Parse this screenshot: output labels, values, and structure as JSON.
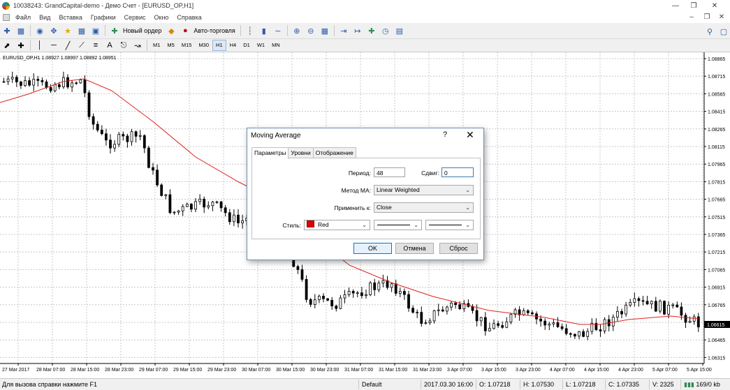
{
  "window": {
    "title": "10038243: GrandCapital-demo - Демо Счет - [EURUSD_OP,H1]",
    "minimize": "—",
    "maximize": "❐",
    "close": "✕"
  },
  "menu": {
    "items": [
      "Файл",
      "Вид",
      "Вставка",
      "Графики",
      "Сервис",
      "Окно",
      "Справка"
    ],
    "mdi_minimize": "–",
    "mdi_restore": "❐",
    "mdi_close": "✕"
  },
  "toolbar": {
    "new_order": "Новый ордер",
    "autotrading": "Авто-торговля"
  },
  "timeframes": {
    "items": [
      "M1",
      "M5",
      "M15",
      "M30",
      "H1",
      "H4",
      "D1",
      "W1",
      "MN"
    ],
    "active": "H1"
  },
  "chart": {
    "symbol_info": "EURUSD_OP,H1  1.08927 1.08997 1.08892 1.08951",
    "price_labels": [
      "1.08865",
      "1.08715",
      "1.08565",
      "1.08415",
      "1.08265",
      "1.08115",
      "1.07965",
      "1.07815",
      "1.07665",
      "1.07515",
      "1.07365",
      "1.07215",
      "1.07065",
      "1.06915",
      "1.06765",
      "1.06615",
      "1.06465",
      "1.06315"
    ],
    "price_top_label": "1.08865",
    "current_price": "1.06615",
    "time_labels": [
      "27 Mar 2017",
      "28 Mar 07:00",
      "28 Mar 15:00",
      "28 Mar 23:00",
      "29 Mar 07:00",
      "29 Mar 15:00",
      "29 Mar 23:00",
      "30 Mar 07:00",
      "30 Mar 15:00",
      "30 Mar 23:00",
      "31 Mar 07:00",
      "31 Mar 15:00",
      "31 Mar 23:00",
      "3 Apr 07:00",
      "3 Apr 15:00",
      "3 Apr 23:00",
      "4 Apr 07:00",
      "4 Apr 15:00",
      "4 Apr 23:00",
      "5 Apr 07:00",
      "5 Apr 15:00"
    ],
    "ma_color": "#e02020",
    "candle_color": "#000000"
  },
  "dialog": {
    "title": "Moving Average",
    "help": "?",
    "close": "✕",
    "tabs": [
      "Параметры",
      "Уровни",
      "Отображение"
    ],
    "active_tab": "Параметры",
    "period_label": "Период:",
    "period_value": "48",
    "shift_label": "Сдвиг:",
    "shift_value": "0",
    "method_label": "Метод MA:",
    "method_value": "Linear Weighted",
    "apply_label": "Применить к:",
    "apply_value": "Close",
    "style_label": "Стиль:",
    "style_color": "Red",
    "ok": "OK",
    "cancel": "Отмена",
    "reset": "Сброс"
  },
  "status": {
    "help": "Для вызова справки нажмите F1",
    "profile": "Default",
    "datetime": "2017.03.30 16:00",
    "open": "O: 1.07218",
    "high": "H: 1.07530",
    "low": "L: 1.07218",
    "close": "C: 1.07335",
    "volume": "V: 2325",
    "traffic": "169/0 kb"
  }
}
